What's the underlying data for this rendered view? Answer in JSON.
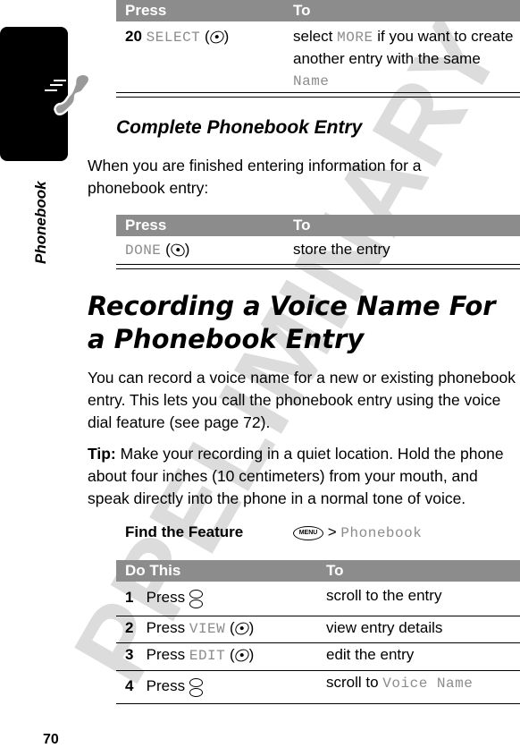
{
  "watermark": "PRELIMINARY",
  "side_tab": {
    "label": "Phonebook",
    "icon": "phone-handset-icon"
  },
  "page_number": "70",
  "table_top": {
    "headers": [
      "Press",
      "To"
    ],
    "rows": [
      {
        "step": "20",
        "key_label": "SELECT",
        "key_icon": "left-softkey-icon",
        "to_pre": "select ",
        "to_key": "MORE",
        "to_mid": " if you want to create another entry with the same ",
        "to_key2": "Name"
      }
    ]
  },
  "section_complete": {
    "title": "Complete Phonebook Entry",
    "intro": "When you are finished entering information for a phonebook entry:",
    "table": {
      "headers": [
        "Press",
        "To"
      ],
      "rows": [
        {
          "key_label": "DONE",
          "key_icon": "right-softkey-icon",
          "to": "store the entry"
        }
      ]
    }
  },
  "section_voice": {
    "title": "Recording a Voice Name For a Phonebook Entry",
    "para1": "You can record a voice name for a new or existing phonebook entry. This lets you call the phonebook entry using the voice dial feature (see page 72).",
    "tip_label": "Tip:",
    "tip_text": " Make your recording in a quiet location. Hold the phone about four inches (10 centimeters) from your mouth, and speak directly into the phone in a normal tone of voice.",
    "find_feature": {
      "label": "Find the Feature",
      "menu_key": "MENU",
      "separator": ">",
      "path": "Phonebook"
    },
    "table": {
      "headers": [
        "Do This",
        "To"
      ],
      "rows": [
        {
          "n": "1",
          "press": "Press",
          "key": "",
          "icon": "nav-scroll-icon",
          "to": "scroll to the entry",
          "to_key": ""
        },
        {
          "n": "2",
          "press": "Press",
          "key": "VIEW",
          "icon": "left-softkey-icon",
          "to": "view entry details",
          "to_key": ""
        },
        {
          "n": "3",
          "press": "Press",
          "key": "EDIT",
          "icon": "left-softkey-icon",
          "to": "edit the entry",
          "to_key": ""
        },
        {
          "n": "4",
          "press": "Press",
          "key": "",
          "icon": "nav-scroll-icon",
          "to": "scroll to ",
          "to_key": "Voice Name"
        }
      ]
    }
  }
}
